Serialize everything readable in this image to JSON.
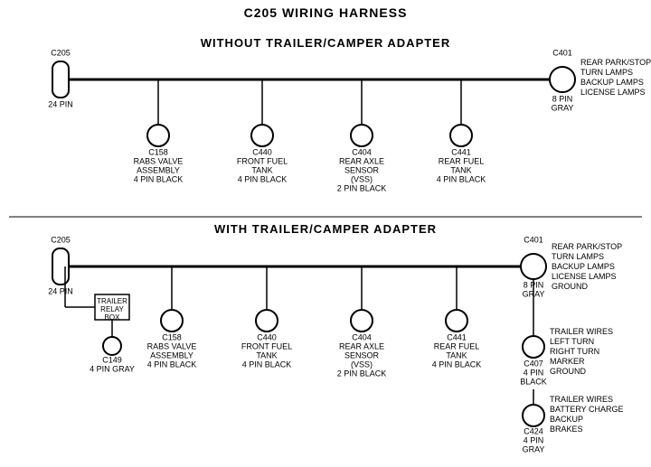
{
  "title": "C205 WIRING HARNESS",
  "section1": {
    "label": "WITHOUT  TRAILER/CAMPER  ADAPTER",
    "c205": {
      "label": "C205",
      "pin": "24 PIN"
    },
    "c401": {
      "label": "C401",
      "pin": "8 PIN",
      "color": "GRAY",
      "desc": [
        "REAR PARK/STOP",
        "TURN LAMPS",
        "BACKUP LAMPS",
        "LICENSE LAMPS"
      ]
    },
    "connectors": [
      {
        "id": "C158",
        "label": "C158",
        "desc": [
          "RABS VALVE",
          "ASSEMBLY",
          "4 PIN BLACK"
        ]
      },
      {
        "id": "C440",
        "label": "C440",
        "desc": [
          "FRONT FUEL",
          "TANK",
          "4 PIN BLACK"
        ]
      },
      {
        "id": "C404",
        "label": "C404",
        "desc": [
          "REAR AXLE",
          "SENSOR",
          "(VSS)",
          "2 PIN BLACK"
        ]
      },
      {
        "id": "C441",
        "label": "C441",
        "desc": [
          "REAR FUEL",
          "TANK",
          "4 PIN BLACK"
        ]
      }
    ]
  },
  "section2": {
    "label": "WITH  TRAILER/CAMPER  ADAPTER",
    "c205": {
      "label": "C205",
      "pin": "24 PIN"
    },
    "c401": {
      "label": "C401",
      "pin": "8 PIN",
      "color": "GRAY",
      "desc": [
        "REAR PARK/STOP",
        "TURN LAMPS",
        "BACKUP LAMPS",
        "LICENSE LAMPS",
        "GROUND"
      ]
    },
    "trailer_relay": {
      "label": "TRAILER",
      "label2": "RELAY",
      "label3": "BOX"
    },
    "c149": {
      "label": "C149",
      "pin": "4 PIN GRAY"
    },
    "c407": {
      "label": "C407",
      "pin": "4 PIN",
      "color": "BLACK",
      "desc": [
        "TRAILER WIRES",
        "LEFT TURN",
        "RIGHT TURN",
        "MARKER",
        "GROUND"
      ]
    },
    "c424": {
      "label": "C424",
      "pin": "4 PIN",
      "color": "GRAY",
      "desc": [
        "TRAILER WIRES",
        "BATTERY CHARGE",
        "BACKUP",
        "BRAKES"
      ]
    },
    "connectors": [
      {
        "id": "C158",
        "label": "C158",
        "desc": [
          "RABS VALVE",
          "ASSEMBLY",
          "4 PIN BLACK"
        ]
      },
      {
        "id": "C440",
        "label": "C440",
        "desc": [
          "FRONT FUEL",
          "TANK",
          "4 PIN BLACK"
        ]
      },
      {
        "id": "C404",
        "label": "C404",
        "desc": [
          "REAR AXLE",
          "SENSOR",
          "(VSS)",
          "2 PIN BLACK"
        ]
      },
      {
        "id": "C441",
        "label": "C441",
        "desc": [
          "REAR FUEL",
          "TANK",
          "4 PIN BLACK"
        ]
      }
    ]
  }
}
